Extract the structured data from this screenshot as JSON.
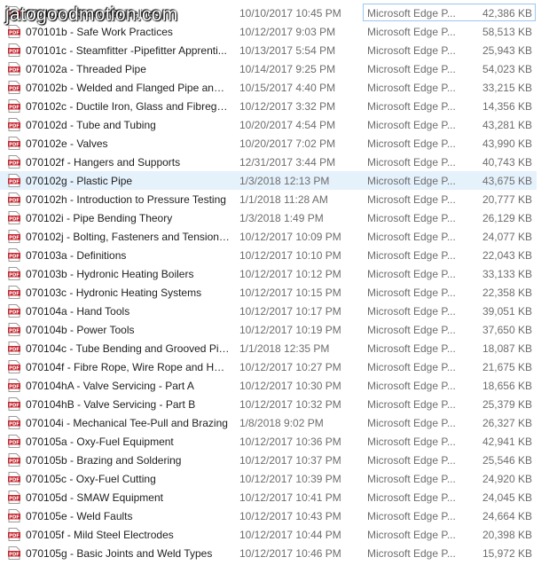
{
  "watermark": "jatogoodmotion.com",
  "accent": "#e5f1fb",
  "pdf_icon_color": "#c4262e",
  "icon": "pdf-file-icon",
  "files": [
    {
      "name": "070101a - Safety Guidelines",
      "date": "10/10/2017 10:45 PM",
      "type": "Microsoft Edge P...",
      "size": "42,386 KB"
    },
    {
      "name": "070101b - Safe Work Practices",
      "date": "10/12/2017 9:03 PM",
      "type": "Microsoft Edge P...",
      "size": "58,513 KB"
    },
    {
      "name": "070101c - Steamfitter -Pipefitter Apprenti...",
      "date": "10/13/2017 5:54 PM",
      "type": "Microsoft Edge P...",
      "size": "25,943 KB"
    },
    {
      "name": "070102a - Threaded Pipe",
      "date": "10/14/2017 9:25 PM",
      "type": "Microsoft Edge P...",
      "size": "54,023 KB"
    },
    {
      "name": "070102b - Welded and Flanged Pipe and ...",
      "date": "10/15/2017 4:40 PM",
      "type": "Microsoft Edge P...",
      "size": "33,215 KB"
    },
    {
      "name": "070102c - Ductile Iron, Glass and Fibregla...",
      "date": "10/12/2017 3:32 PM",
      "type": "Microsoft Edge P...",
      "size": "14,356 KB"
    },
    {
      "name": "070102d - Tube and Tubing",
      "date": "10/20/2017 4:54 PM",
      "type": "Microsoft Edge P...",
      "size": "43,281 KB"
    },
    {
      "name": "070102e - Valves",
      "date": "10/20/2017 7:02 PM",
      "type": "Microsoft Edge P...",
      "size": "43,990 KB"
    },
    {
      "name": "070102f - Hangers and Supports",
      "date": "12/31/2017 3:44 PM",
      "type": "Microsoft Edge P...",
      "size": "40,743 KB"
    },
    {
      "name": "070102g - Plastic Pipe",
      "date": "1/3/2018 12:13 PM",
      "type": "Microsoft Edge P...",
      "size": "43,675 KB",
      "selected": true
    },
    {
      "name": "070102h - Introduction to Pressure Testing",
      "date": "1/1/2018 11:28 AM",
      "type": "Microsoft Edge P...",
      "size": "20,777 KB"
    },
    {
      "name": "070102i - Pipe Bending Theory",
      "date": "1/3/2018 1:49 PM",
      "type": "Microsoft Edge P...",
      "size": "26,129 KB"
    },
    {
      "name": "070102j - Bolting, Fasteners and Tensioning",
      "date": "10/12/2017 10:09 PM",
      "type": "Microsoft Edge P...",
      "size": "24,077 KB"
    },
    {
      "name": "070103a - Definitions",
      "date": "10/12/2017 10:10 PM",
      "type": "Microsoft Edge P...",
      "size": "22,043 KB"
    },
    {
      "name": "070103b - Hydronic Heating Boilers",
      "date": "10/12/2017 10:12 PM",
      "type": "Microsoft Edge P...",
      "size": "33,133 KB"
    },
    {
      "name": "070103c - Hydronic Heating Systems",
      "date": "10/12/2017 10:15 PM",
      "type": "Microsoft Edge P...",
      "size": "22,358 KB"
    },
    {
      "name": "070104a - Hand Tools",
      "date": "10/12/2017 10:17 PM",
      "type": "Microsoft Edge P...",
      "size": "39,051 KB"
    },
    {
      "name": "070104b - Power Tools",
      "date": "10/12/2017 10:19 PM",
      "type": "Microsoft Edge P...",
      "size": "37,650 KB"
    },
    {
      "name": "070104c - Tube Bending and Grooved Pipe",
      "date": "1/1/2018 12:35 PM",
      "type": "Microsoft Edge P...",
      "size": "18,087 KB"
    },
    {
      "name": "070104f - Fibre Rope, Wire Rope and Han...",
      "date": "10/12/2017 10:27 PM",
      "type": "Microsoft Edge P...",
      "size": "21,675 KB"
    },
    {
      "name": "070104hA - Valve Servicing - Part A",
      "date": "10/12/2017 10:30 PM",
      "type": "Microsoft Edge P...",
      "size": "18,656 KB"
    },
    {
      "name": "070104hB - Valve Servicing - Part B",
      "date": "10/12/2017 10:32 PM",
      "type": "Microsoft Edge P...",
      "size": "25,379 KB"
    },
    {
      "name": "070104i - Mechanical Tee-Pull and Brazing",
      "date": "1/8/2018 9:02 PM",
      "type": "Microsoft Edge P...",
      "size": "26,327 KB"
    },
    {
      "name": "070105a - Oxy-Fuel Equipment",
      "date": "10/12/2017 10:36 PM",
      "type": "Microsoft Edge P...",
      "size": "42,941 KB"
    },
    {
      "name": "070105b - Brazing and Soldering",
      "date": "10/12/2017 10:37 PM",
      "type": "Microsoft Edge P...",
      "size": "25,546 KB"
    },
    {
      "name": "070105c - Oxy-Fuel Cutting",
      "date": "10/12/2017 10:39 PM",
      "type": "Microsoft Edge P...",
      "size": "24,920 KB"
    },
    {
      "name": "070105d - SMAW Equipment",
      "date": "10/12/2017 10:41 PM",
      "type": "Microsoft Edge P...",
      "size": "24,045 KB"
    },
    {
      "name": "070105e - Weld Faults",
      "date": "10/12/2017 10:43 PM",
      "type": "Microsoft Edge P...",
      "size": "24,664 KB"
    },
    {
      "name": "070105f - Mild Steel Electrodes",
      "date": "10/12/2017 10:44 PM",
      "type": "Microsoft Edge P...",
      "size": "20,398 KB"
    },
    {
      "name": "070105g - Basic Joints and Weld Types",
      "date": "10/12/2017 10:46 PM",
      "type": "Microsoft Edge P...",
      "size": "15,972 KB"
    }
  ]
}
